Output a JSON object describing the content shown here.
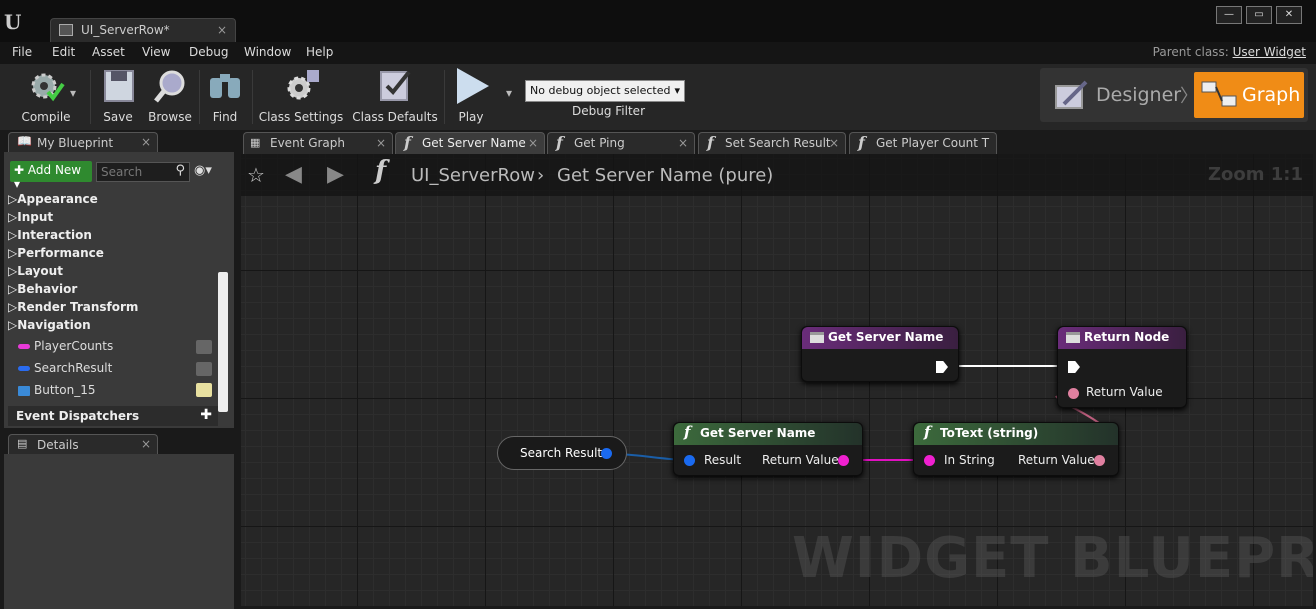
{
  "window": {
    "tab_title": "UI_ServerRow*",
    "close": "×",
    "buttons": [
      "—",
      "▭",
      "✕"
    ]
  },
  "menu": [
    "File",
    "Edit",
    "Asset",
    "View",
    "Debug",
    "Window",
    "Help"
  ],
  "parent_class": {
    "label": "Parent class:",
    "value": "User Widget"
  },
  "toolbar": {
    "compile": "Compile",
    "save": "Save",
    "browse": "Browse",
    "find": "Find",
    "class_settings": "Class Settings",
    "class_defaults": "Class Defaults",
    "play": "Play",
    "debug_object": "No debug object selected",
    "debug_filter": "Debug Filter"
  },
  "modes": {
    "designer": "Designer",
    "graph": "Graph"
  },
  "my_blueprint": {
    "tab": "My Blueprint",
    "add_new": "Add New",
    "search_placeholder": "Search",
    "categories": [
      "Appearance",
      "Input",
      "Interaction",
      "Performance",
      "Layout",
      "Behavior",
      "Render Transform",
      "Navigation"
    ],
    "variables": [
      {
        "name": "PlayerCounts",
        "color": "#e83ad8"
      },
      {
        "name": "SearchResult",
        "color": "#2a6cf0"
      },
      {
        "name": "Button_15",
        "color": "#3a8ad8"
      }
    ],
    "event_dispatchers": "Event Dispatchers"
  },
  "details": {
    "tab": "Details"
  },
  "graph_tabs": [
    "Event Graph",
    "Get Server Name",
    "Get Ping",
    "Set Search Result",
    "Get Player Count T"
  ],
  "breadcrumb": {
    "blueprint": "UI_ServerRow",
    "function": "Get Server Name (pure)"
  },
  "zoom": "Zoom 1:1",
  "watermark": "WIDGET BLUEPRINT",
  "nodes": {
    "entry": {
      "title": "Get Server Name"
    },
    "return": {
      "title": "Return Node",
      "pin": "Return Value"
    },
    "search_result": {
      "label": "Search Result"
    },
    "get_server_name": {
      "title": "Get Server Name",
      "in": "Result",
      "out": "Return Value"
    },
    "to_text": {
      "title": "ToText (string)",
      "in": "In String",
      "out": "Return Value"
    }
  }
}
